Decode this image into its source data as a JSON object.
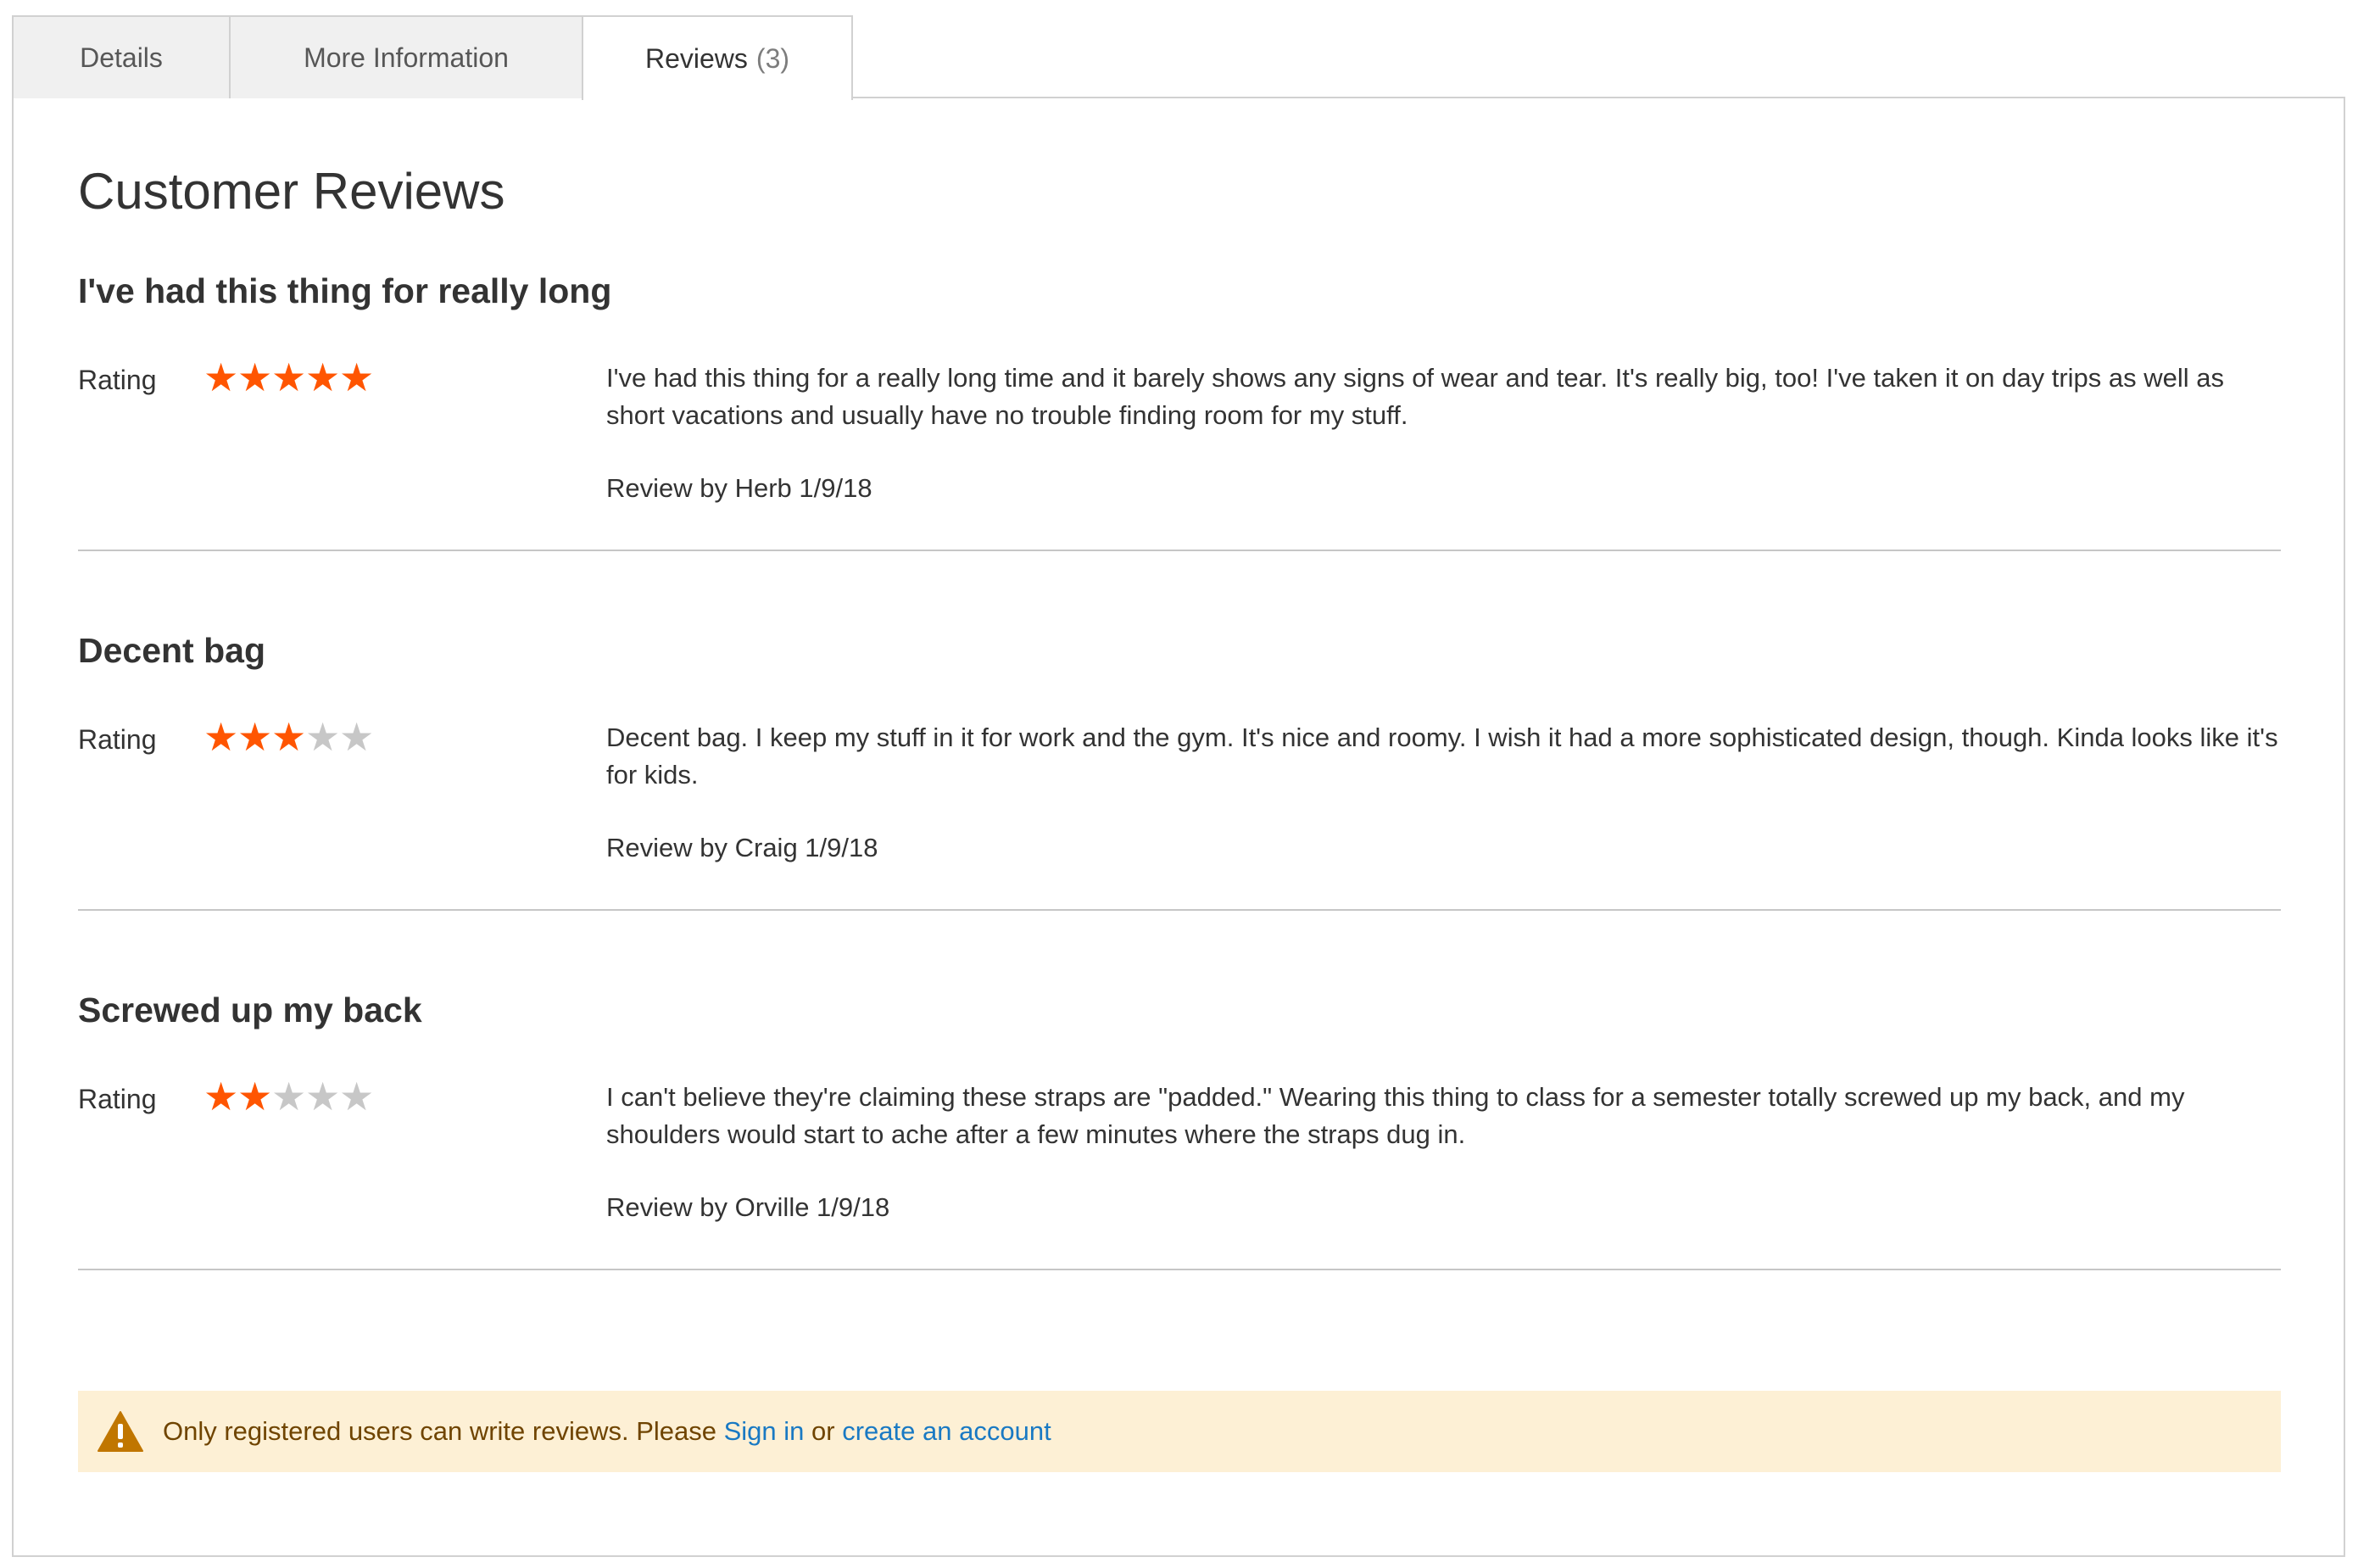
{
  "tabs": {
    "details": "Details",
    "more_information": "More Information",
    "reviews": "Reviews",
    "reviews_count": "(3)"
  },
  "section_title": "Customer Reviews",
  "rating_label": "Rating",
  "reviews": [
    {
      "title": "I've had this thing for really long",
      "rating": 5,
      "rating_max": 5,
      "body": "I've had this thing for a really long time and it barely shows any signs of wear and tear. It's really big, too! I've taken it on day trips as well as short vacations and usually have no trouble finding room for my stuff.",
      "meta": "Review by Herb 1/9/18"
    },
    {
      "title": "Decent bag",
      "rating": 3,
      "rating_max": 5,
      "body": "Decent bag. I keep my stuff in it for work and the gym. It's nice and roomy. I wish it had a more sophisticated design, though. Kinda looks like it's for kids.",
      "meta": "Review by Craig 1/9/18"
    },
    {
      "title": "Screwed up my back",
      "rating": 2,
      "rating_max": 5,
      "body": "I can't believe they're claiming these straps are \"padded.\" Wearing this thing to class for a semester totally screwed up my back, and my shoulders would start to ache after a few minutes where the straps dug in.",
      "meta": "Review by Orville 1/9/18"
    }
  ],
  "notice": {
    "icon": "warning-icon",
    "text": "Only registered users can write reviews. Please",
    "sign_in": "Sign in",
    "or": "or",
    "create_account": "create an account"
  },
  "colors": {
    "star_filled": "#ff5501",
    "star_empty": "#c7c7c7",
    "link": "#1979c3",
    "notice_bg": "#fdf0d5",
    "warning_icon": "#c07600"
  }
}
